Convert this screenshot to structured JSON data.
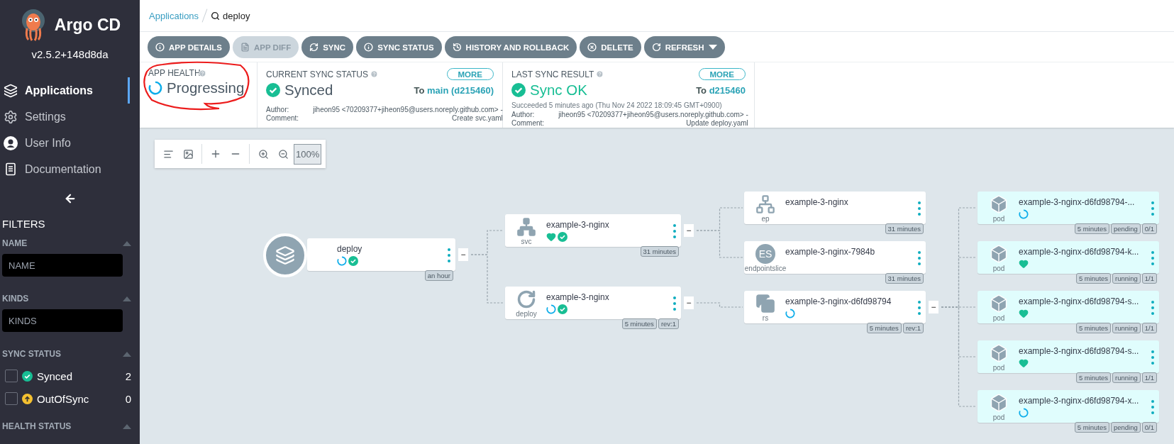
{
  "sidebar": {
    "brand": "Argo CD",
    "version": "v2.5.2+148d8da",
    "nav": [
      {
        "label": "Applications",
        "kind": "apps",
        "selected": true
      },
      {
        "label": "Settings",
        "kind": "settings",
        "selected": false
      },
      {
        "label": "User Info",
        "kind": "user",
        "selected": false
      },
      {
        "label": "Documentation",
        "kind": "docs",
        "selected": false
      }
    ],
    "filters_title": "FILTERS",
    "filters": [
      {
        "title": "NAME",
        "kind": "input",
        "placeholder": "NAME"
      },
      {
        "title": "KINDS",
        "kind": "input",
        "placeholder": "KINDS"
      },
      {
        "title": "SYNC STATUS",
        "kind": "checklist",
        "options": [
          {
            "label": "Synced",
            "kind": "synced",
            "count": "2",
            "checked": false
          },
          {
            "label": "OutOfSync",
            "kind": "outofsync",
            "count": "0",
            "checked": false
          }
        ]
      },
      {
        "title": "HEALTH STATUS",
        "kind": "header"
      }
    ]
  },
  "breadcrumb": {
    "link": "Applications",
    "search": "deploy"
  },
  "toolbar": [
    {
      "label": "APP DETAILS",
      "kind": "info",
      "disabled": false,
      "dropdown": false
    },
    {
      "label": "APP DIFF",
      "kind": "diff",
      "disabled": true,
      "dropdown": false
    },
    {
      "label": "SYNC",
      "kind": "sync",
      "disabled": false,
      "dropdown": false
    },
    {
      "label": "SYNC STATUS",
      "kind": "info",
      "disabled": false,
      "dropdown": false
    },
    {
      "label": "HISTORY AND ROLLBACK",
      "kind": "history",
      "disabled": false,
      "dropdown": false
    },
    {
      "label": "DELETE",
      "kind": "delete",
      "disabled": false,
      "dropdown": false
    },
    {
      "label": "REFRESH",
      "kind": "refresh",
      "disabled": false,
      "dropdown": true
    }
  ],
  "status": {
    "app_health": {
      "title": "APP HEALTH",
      "value": "Progressing",
      "kind": "progressing",
      "annotated": true
    },
    "current_sync": {
      "title": "CURRENT SYNC STATUS",
      "more": "MORE",
      "value": "Synced",
      "to": "To",
      "revision": "main (d215460)",
      "author_label": "Author:",
      "author": "jiheon95 <70209377+jiheon95@users.noreply.github.com> -",
      "comment_label": "Comment:",
      "comment": "Create svc.yaml"
    },
    "last_sync": {
      "title": "LAST SYNC RESULT",
      "more": "MORE",
      "value": "Sync OK",
      "to": "To",
      "revision": "d215460",
      "detail": "Succeeded 5 minutes ago (Thu Nov 24 2022 18:09:45 GMT+0900)",
      "author_label": "Author:",
      "author": "jiheon95 <70209377+jiheon95@users.noreply.github.com> -",
      "comment_label": "Comment:",
      "comment": "Update deploy.yaml"
    }
  },
  "canvas_toolbar": {
    "zoom": "100%"
  },
  "graph": {
    "root": {
      "name": "deploy",
      "kind": "application",
      "statuses": [
        {
          "kind": "progressing"
        },
        {
          "kind": "synced"
        }
      ],
      "tags": [
        "an hour"
      ],
      "collapse": "−",
      "children": [
        {
          "name": "example-3-nginx",
          "kind": "svc",
          "type_label": "svc",
          "statuses": [
            {
              "kind": "healthy"
            },
            {
              "kind": "synced"
            }
          ],
          "tags": [
            "31 minutes"
          ],
          "collapse": "−",
          "children": [
            {
              "name": "example-3-nginx",
              "kind": "ep",
              "type_label": "ep",
              "tags": [
                "31 minutes"
              ]
            },
            {
              "name": "example-3-nginx-7984b",
              "kind": "endpointslice",
              "type_label": "endpointslice",
              "icon_text": "ES",
              "tags": [
                "31 minutes"
              ]
            }
          ]
        },
        {
          "name": "example-3-nginx",
          "kind": "deploy",
          "type_label": "deploy",
          "statuses": [
            {
              "kind": "progressing"
            },
            {
              "kind": "synced"
            }
          ],
          "tags": [
            "5 minutes",
            "rev:1"
          ],
          "collapse": "−",
          "children": [
            {
              "name": "example-3-nginx-d6fd98794",
              "kind": "rs",
              "type_label": "rs",
              "statuses": [
                {
                  "kind": "progressing"
                }
              ],
              "tags": [
                "5 minutes",
                "rev:1"
              ],
              "collapse": "−",
              "children": [
                {
                  "name": "example-3-nginx-d6fd98794-...",
                  "kind": "pod",
                  "type_label": "pod",
                  "statuses": [
                    {
                      "kind": "progressing"
                    }
                  ],
                  "tags": [
                    "5 minutes",
                    "pending",
                    "0/1"
                  ]
                },
                {
                  "name": "example-3-nginx-d6fd98794-k...",
                  "kind": "pod",
                  "type_label": "pod",
                  "statuses": [
                    {
                      "kind": "healthy"
                    }
                  ],
                  "tags": [
                    "5 minutes",
                    "running",
                    "1/1"
                  ]
                },
                {
                  "name": "example-3-nginx-d6fd98794-s...",
                  "kind": "pod",
                  "type_label": "pod",
                  "statuses": [
                    {
                      "kind": "healthy"
                    }
                  ],
                  "tags": [
                    "5 minutes",
                    "running",
                    "1/1"
                  ]
                },
                {
                  "name": "example-3-nginx-d6fd98794-s...",
                  "kind": "pod",
                  "type_label": "pod",
                  "statuses": [
                    {
                      "kind": "healthy"
                    }
                  ],
                  "tags": [
                    "5 minutes",
                    "running",
                    "1/1"
                  ]
                },
                {
                  "name": "example-3-nginx-d6fd98794-x...",
                  "kind": "pod",
                  "type_label": "pod",
                  "statuses": [
                    {
                      "kind": "progressing"
                    }
                  ],
                  "tags": [
                    "5 minutes",
                    "pending",
                    "0/1"
                  ]
                }
              ]
            }
          ]
        }
      ]
    }
  }
}
